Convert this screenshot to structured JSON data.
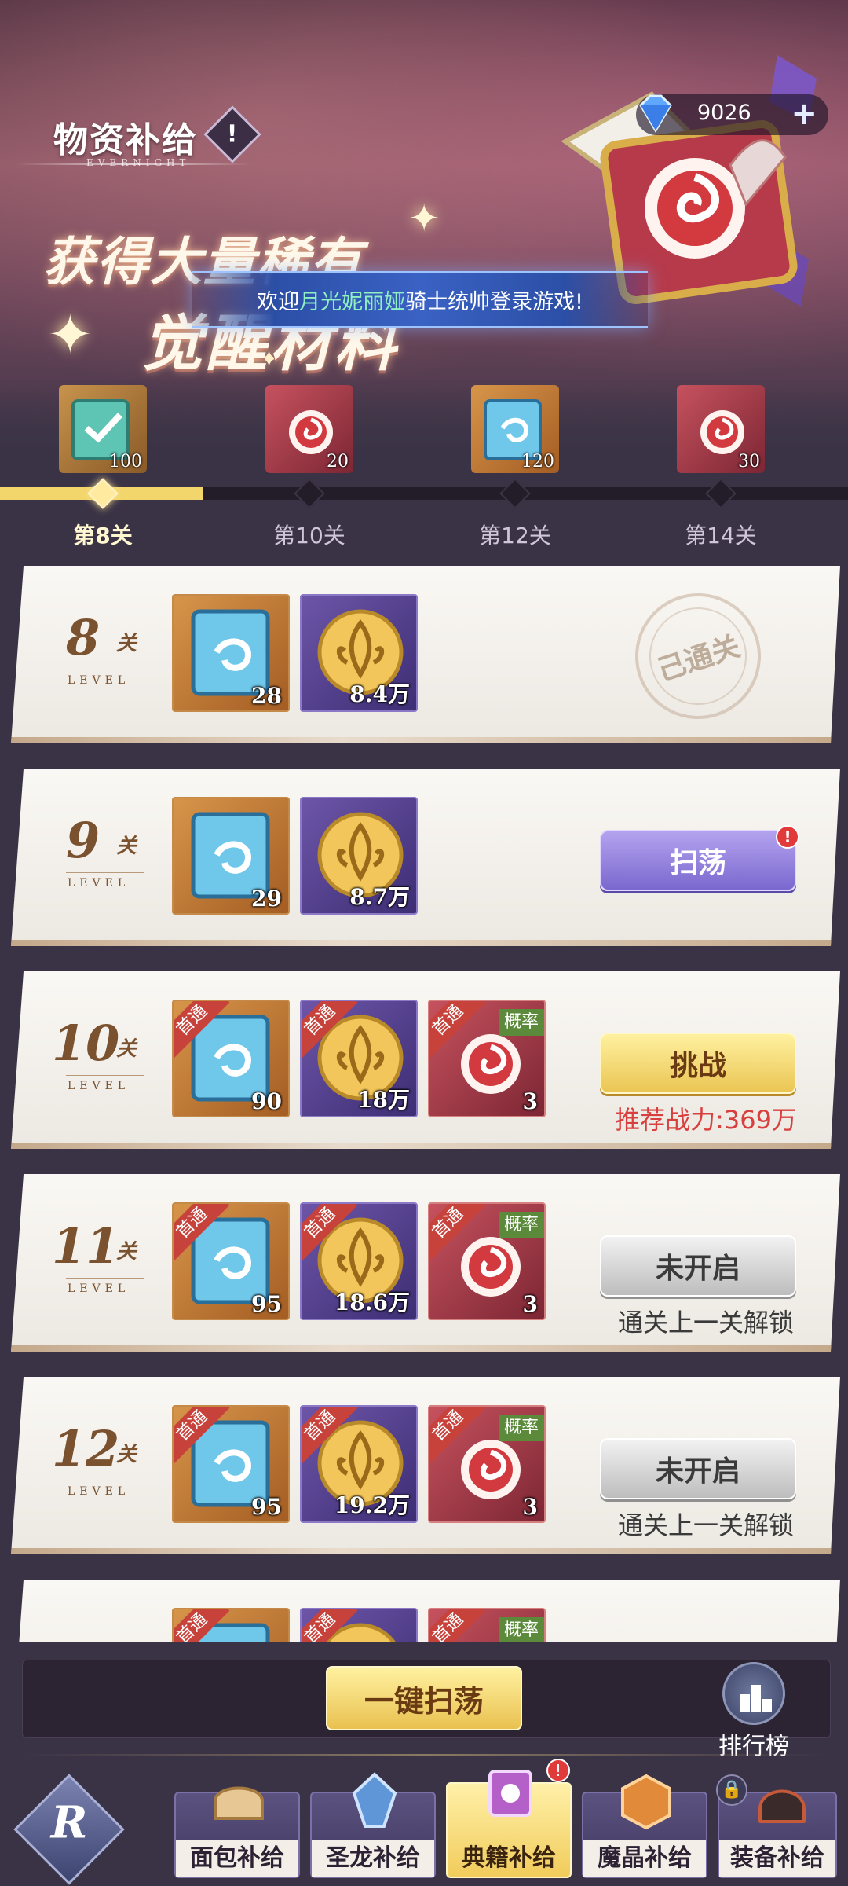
{
  "header": {
    "title": "物资补给",
    "subtitle": "EVERNIGHT",
    "slogan_line1": "获得大量稀有",
    "slogan_line2": "觉醒材料",
    "marquee_prefix": "欢迎",
    "marquee_name": "月光妮丽娅",
    "marquee_suffix": "骑士统帅登录游戏!",
    "currency_amount": "9026",
    "currency_icon": "diamond-icon"
  },
  "reward_track": {
    "progress_fraction": 0.24,
    "rewards": [
      {
        "icon": "green-tome-icon",
        "count": "100"
      },
      {
        "icon": "red-tome-icon",
        "count": "20"
      },
      {
        "icon": "blue-tome-icon",
        "count": "120"
      },
      {
        "icon": "red-tome-icon",
        "count": "30"
      }
    ],
    "labels": [
      "第8关",
      "第10关",
      "第12关",
      "第14关"
    ]
  },
  "stages": [
    {
      "num": "8",
      "guan": "关",
      "level_en": "LEVEL",
      "items": [
        {
          "type": "book",
          "count": "28"
        },
        {
          "type": "coin",
          "count": "8.4万"
        }
      ],
      "status": "己通关"
    },
    {
      "num": "9",
      "guan": "关",
      "level_en": "LEVEL",
      "items": [
        {
          "type": "book",
          "count": "29"
        },
        {
          "type": "coin",
          "count": "8.7万"
        }
      ],
      "button": "扫荡"
    },
    {
      "num": "10",
      "guan": "关",
      "level_en": "LEVEL",
      "items": [
        {
          "type": "book",
          "count": "90",
          "tag": "首通"
        },
        {
          "type": "coin",
          "count": "18万",
          "tag": "首通"
        },
        {
          "type": "tome",
          "count": "3",
          "tag": "首通",
          "prob": "概率"
        }
      ],
      "button": "挑战",
      "note": "推荐战力:369万"
    },
    {
      "num": "11",
      "guan": "关",
      "level_en": "LEVEL",
      "items": [
        {
          "type": "book",
          "count": "95",
          "tag": "首通"
        },
        {
          "type": "coin",
          "count": "18.6万",
          "tag": "首通"
        },
        {
          "type": "tome",
          "count": "3",
          "tag": "首通",
          "prob": "概率"
        }
      ],
      "button": "未开启",
      "note": "通关上一关解锁"
    },
    {
      "num": "12",
      "guan": "关",
      "level_en": "LEVEL",
      "items": [
        {
          "type": "book",
          "count": "95",
          "tag": "首通"
        },
        {
          "type": "coin",
          "count": "19.2万",
          "tag": "首通"
        },
        {
          "type": "tome",
          "count": "3",
          "tag": "首通",
          "prob": "概率"
        }
      ],
      "button": "未开启",
      "note": "通关上一关解锁"
    },
    {
      "num": "",
      "guan": "",
      "level_en": "",
      "items": [
        {
          "type": "book",
          "count": "",
          "tag": "首通"
        },
        {
          "type": "coin",
          "count": "",
          "tag": "首通"
        },
        {
          "type": "tome",
          "count": "",
          "tag": "首通",
          "prob": "概率"
        }
      ]
    }
  ],
  "bottom": {
    "one_click": "一键扫荡",
    "ranking": "排行榜"
  },
  "nav": {
    "logo_letter": "R",
    "tabs": [
      {
        "label": "面包补给",
        "icon": "bread-icon"
      },
      {
        "label": "圣龙补给",
        "icon": "dragon-crystal-icon"
      },
      {
        "label": "典籍补给",
        "icon": "tome-icon",
        "active": true,
        "badge": "!"
      },
      {
        "label": "魔晶补给",
        "icon": "magic-cube-icon"
      },
      {
        "label": "装备补给",
        "icon": "helmet-icon",
        "locked": true
      }
    ]
  }
}
